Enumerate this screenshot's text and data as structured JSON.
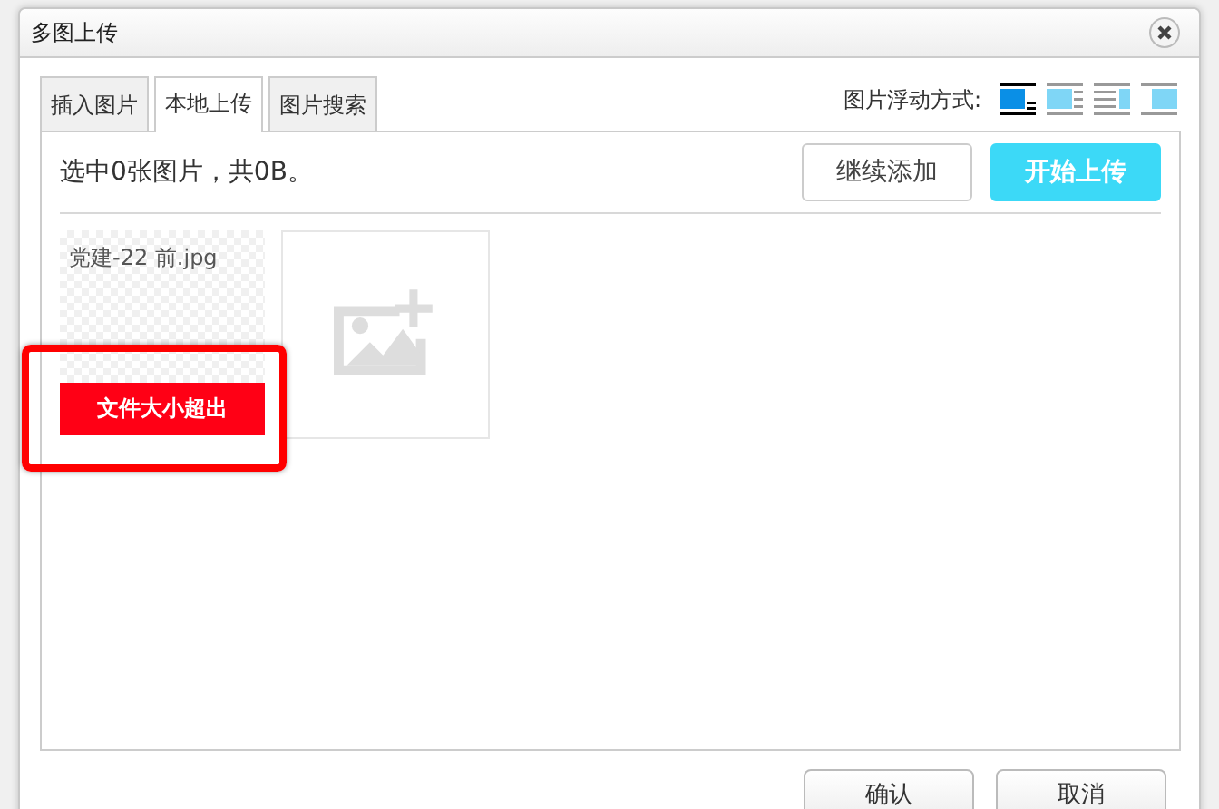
{
  "window": {
    "title": "多图上传"
  },
  "tabs": [
    {
      "label": "插入图片",
      "selected": false
    },
    {
      "label": "本地上传",
      "selected": true
    },
    {
      "label": "图片搜索",
      "selected": false
    }
  ],
  "float_options": {
    "label": "图片浮动方式:",
    "items": [
      {
        "kind": "none",
        "selected": true
      },
      {
        "kind": "left",
        "selected": false
      },
      {
        "kind": "right",
        "selected": false
      },
      {
        "kind": "center",
        "selected": false
      }
    ]
  },
  "upload": {
    "summary": "选中0张图片，共0B。",
    "add_button": "继续添加",
    "start_button": "开始上传",
    "files": [
      {
        "name": "党建-22 前.jpg",
        "error": "文件大小超出",
        "highlighted": true
      }
    ]
  },
  "buttons": [
    "确认",
    "取消"
  ]
}
